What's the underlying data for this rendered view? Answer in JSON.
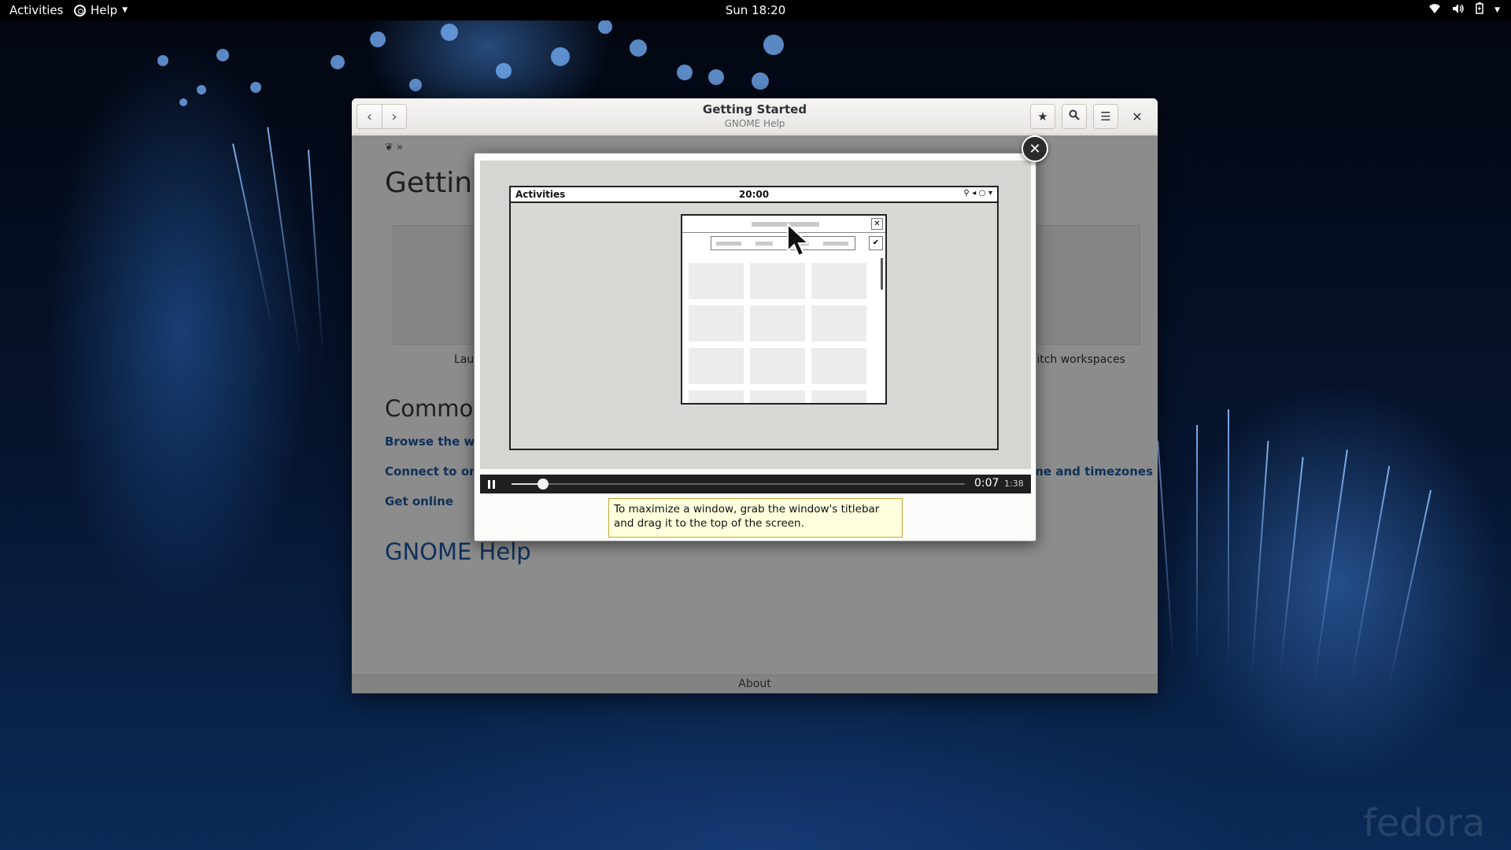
{
  "topbar": {
    "activities": "Activities",
    "app_menu": "Help",
    "clock": "Sun 18:20"
  },
  "window": {
    "title": "Getting Started",
    "subtitle": "GNOME Help",
    "page_title": "Getting Started",
    "thumb_left_label": "Launch applications",
    "thumb_right_label": "Switch workspaces",
    "section_title": "Common Tasks",
    "links": [
      "Browse the web",
      "Connect to online accounts",
      "Get online"
    ],
    "link_right": "Change the date, time and timezones",
    "help_title": "GNOME Help",
    "footer": "About"
  },
  "video": {
    "anim_activities": "Activities",
    "anim_clock": "20:00",
    "current_time": "0:07",
    "total_time": "1:38",
    "progress": 0.07,
    "caption": "To maximize a window, grab the window's titlebar and drag it to the top of the screen."
  },
  "brand": "fedora"
}
